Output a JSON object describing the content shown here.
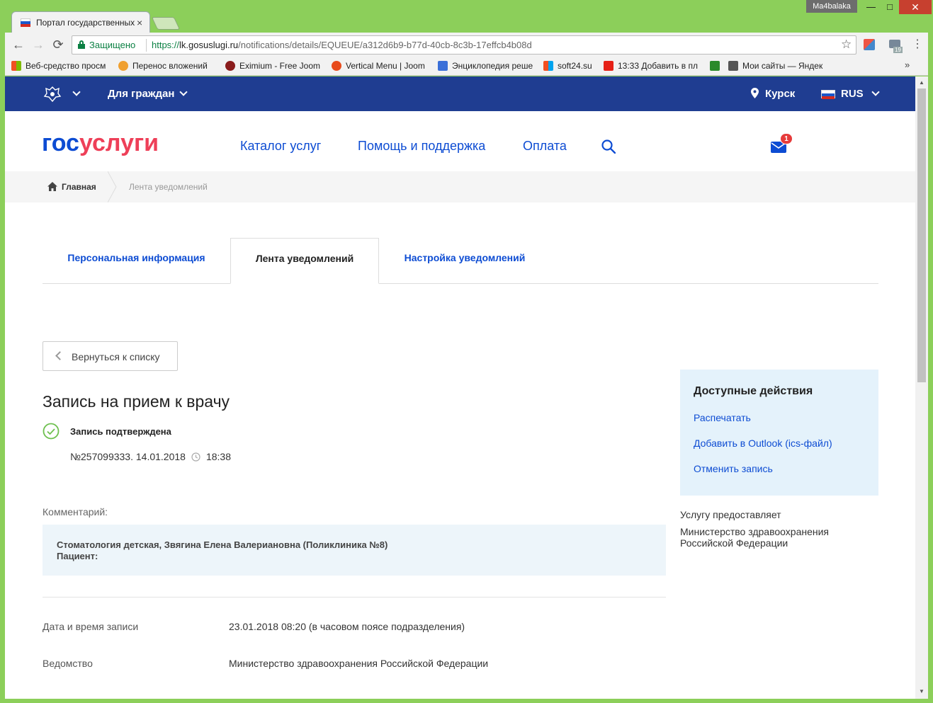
{
  "window": {
    "user": "Ma4balaka",
    "min": "—",
    "max": "□",
    "close": "✕"
  },
  "tab": {
    "title": "Портал государственных",
    "close": "×"
  },
  "toolbar": {
    "back": "←",
    "forward": "→",
    "reload": "⟳",
    "secure_label": "Защищено",
    "url_scheme": "https://",
    "url_host": "lk.gosuslugi.ru",
    "url_path": "/notifications/details/EQUEUE/a312d6b9-b77d-40cb-8c3b-17effcb4b08d",
    "star": "☆",
    "ext_badge": "19",
    "menu": "⋮"
  },
  "bookmarks": [
    {
      "label": "Веб-средство просм",
      "color": "#f25022"
    },
    {
      "label": "Перенос вложений",
      "color": "#f0a030"
    },
    {
      "label": "Eximium - Free Joom",
      "color": "#8a1c1c"
    },
    {
      "label": "Vertical Menu | Joom",
      "color": "#e84b1c"
    },
    {
      "label": "Энциклопедия реше",
      "color": "#3a6fd8"
    },
    {
      "label": "soft24.su",
      "color": "#00a4ef"
    },
    {
      "label": "13:33 Добавить в пл",
      "color": "#e62117"
    },
    {
      "label": "",
      "color": "#2a8a2a"
    },
    {
      "label": "Мои сайты — Яндек",
      "color": "#555555"
    }
  ],
  "bookmarks_more": "»",
  "topbar": {
    "audience": "Для граждан",
    "city": "Курск",
    "language": "RUS"
  },
  "header": {
    "logo_part1": "гос",
    "logo_part2": "услуги",
    "nav": [
      "Каталог услуг",
      "Помощь и поддержка",
      "Оплата"
    ],
    "mail_count": "1"
  },
  "breadcrumb": {
    "home": "Главная",
    "current": "Лента уведомлений"
  },
  "tabs": [
    "Персональная информация",
    "Лента уведомлений",
    "Настройка уведомлений"
  ],
  "back_button": "Вернуться к списку",
  "notification": {
    "title": "Запись на прием к врачу",
    "status": "Запись подтверждена",
    "number_date": "№257099333. 14.01.2018",
    "time": "18:38"
  },
  "comment": {
    "label": "Комментарий:",
    "line1": "Стоматология детская, Звягина Елена Валериановна (Поликлиника №8)",
    "line2": "Пациент:"
  },
  "fields": [
    {
      "label": "Дата и время записи",
      "value": "23.01.2018 08:20 (в часовом поясе подразделения)"
    },
    {
      "label": "Ведомство",
      "value": "Министерство здравоохранения Российской Федерации"
    }
  ],
  "actions": {
    "title": "Доступные действия",
    "items": [
      "Распечатать",
      "Добавить в Outlook (ics-файл)",
      "Отменить запись"
    ]
  },
  "provider": {
    "label": "Услугу предоставляет",
    "name": "Министерство здравоохранения Российской Федерации"
  },
  "colors": {
    "brand_blue": "#0d4cd3",
    "brand_red": "#ee3f58",
    "topbar": "#1f3d91",
    "success": "#6ec04f"
  }
}
